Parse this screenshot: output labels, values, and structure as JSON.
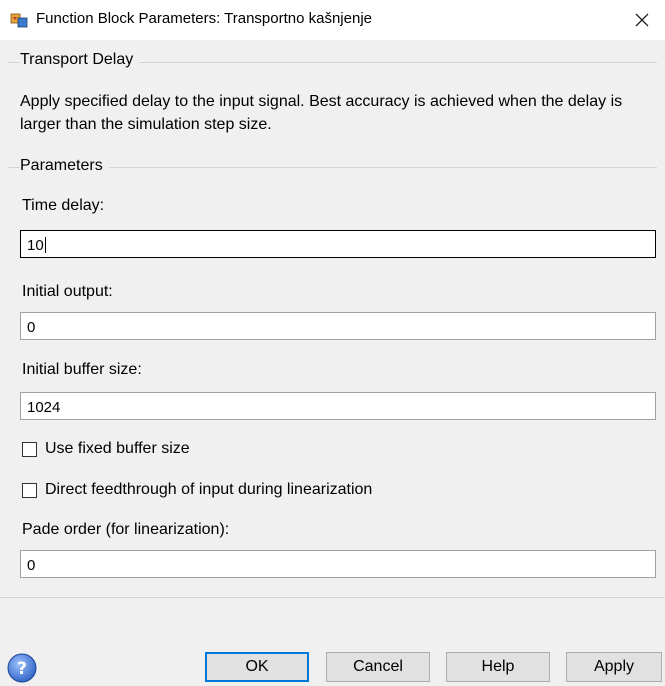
{
  "window": {
    "title": "Function Block Parameters: Transportno kašnjenje",
    "close_glyph": "✕"
  },
  "block_group": {
    "title": "Transport Delay",
    "description": "Apply specified delay to the input signal.  Best accuracy is achieved when the delay is larger than the simulation step size."
  },
  "parameters": {
    "title": "Parameters",
    "time_delay": {
      "label": "Time delay:",
      "value": "10"
    },
    "initial_output": {
      "label": "Initial output:",
      "value": "0"
    },
    "initial_buffer_size": {
      "label": "Initial buffer size:",
      "value": "1024"
    },
    "use_fixed_buffer": {
      "label": "Use fixed buffer size",
      "checked": false
    },
    "direct_feedthrough": {
      "label": "Direct feedthrough of input during linearization",
      "checked": false
    },
    "pade_order": {
      "label": "Pade order (for linearization):",
      "value": "0"
    }
  },
  "buttons": {
    "ok": "OK",
    "cancel": "Cancel",
    "help": "Help",
    "apply": "Apply"
  },
  "icons": {
    "title_icon": "simulink-block-icon",
    "help_icon": "question-circle-icon"
  },
  "colors": {
    "default_button_border": "#0078d7",
    "help_icon": "#3a6fd0"
  }
}
